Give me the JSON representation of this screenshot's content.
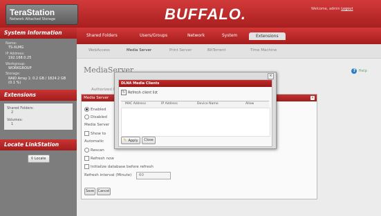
{
  "header": {
    "brand_name": "TeraStation",
    "brand_sub": "Network Attached Storage",
    "logo": "BUFFALO.",
    "welcome_prefix": "Welcome, admin",
    "logout": "Logout"
  },
  "sidebar": {
    "system_info_title": "System Information",
    "info": [
      {
        "label": "Name:",
        "value": "TS-XLMG"
      },
      {
        "label": "IP Address:",
        "value": "192.168.0.25"
      },
      {
        "label": "Workgroup:",
        "value": "WORKGROUP"
      },
      {
        "label": "Storage:",
        "value": "RAID Array 1: 0.2 GB / 1824.2 GB (0.1 %)"
      }
    ],
    "extensions_title": "Extensions",
    "shared_folders_label": "Shared Folders:",
    "shared_folders_count": "2",
    "volumes_label": "Volumes:",
    "volumes_count": "1",
    "locate_title": "Locate LinkStation",
    "locate_button": "Locate"
  },
  "nav": {
    "tabs": [
      "Shared Folders",
      "Users/Groups",
      "Network",
      "System",
      "Extensions"
    ],
    "active": "Extensions"
  },
  "subnav": {
    "items": [
      "WebAccess",
      "Media Server",
      "Print Server",
      "BitTorrent",
      "Time Machine"
    ],
    "active": "Media Server"
  },
  "content": {
    "page_title": "MediaServer",
    "help_label": "Help",
    "subtitle": "Authorized Clients",
    "panel_title": "Media Server",
    "options": {
      "enabled": "Enabled",
      "disabled": "Disabled",
      "mode": "Media Server",
      "show_to": "Show to",
      "automatic": "Automatic",
      "rescan": "Rescan",
      "refresh_now": "Refresh now",
      "init_db": "Initialize database before refresh",
      "refresh_interval_label": "Refresh interval (Minute)",
      "refresh_interval_value": "60"
    },
    "save": "Save",
    "cancel": "Cancel"
  },
  "modal": {
    "title": "DLNA Media Clients",
    "refresh_label": "Refresh client list",
    "columns": [
      "MAC Address",
      "IP Address",
      "Device Name",
      "Allow"
    ],
    "apply": "Apply",
    "close": "Close",
    "close_x": "×"
  }
}
